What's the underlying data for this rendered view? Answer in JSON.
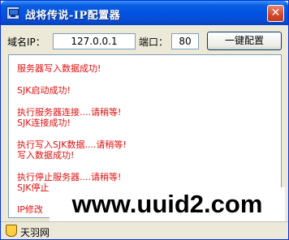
{
  "window": {
    "title": "战将传说-IP配置器",
    "close_glyph": "✕"
  },
  "form": {
    "domain_label": "域名IP：",
    "domain_value": "127.0.0.1",
    "port_label": "端口：",
    "port_value": "80",
    "config_button": "一键配置"
  },
  "log": {
    "entries": [
      "服务器写入数据成功!",
      "SJK启动成功!",
      "执行服务器连接....请稍等!\nSJK连接成功!",
      "执行写入SJK数据....请稍等!\n写入数据成功!",
      "执行停止服务器....请稍等!\nSJK停止",
      "IP修改"
    ],
    "text_color": "#e01010"
  },
  "statusbar": {
    "text": "天羽网"
  },
  "watermark": {
    "text": "www.uuid2.com"
  }
}
